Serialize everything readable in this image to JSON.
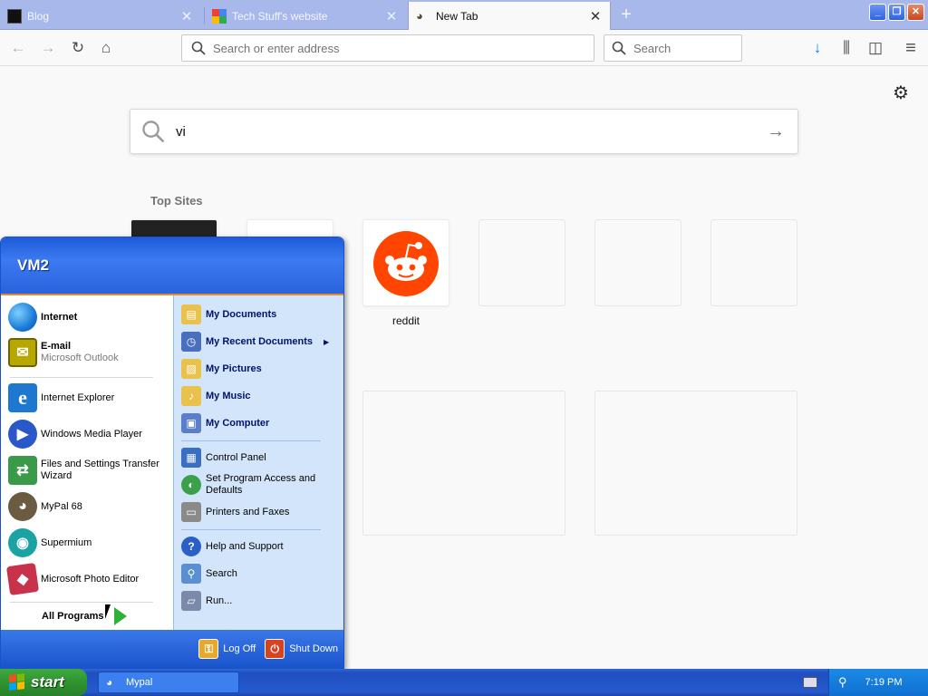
{
  "tabs": [
    {
      "title": "Blog",
      "favicon": "blog-favicon"
    },
    {
      "title": "Tech Stuff's website",
      "favicon": "google-favicon"
    },
    {
      "title": "New Tab",
      "favicon": "mypal-favicon",
      "active": true
    }
  ],
  "new_tab_symbol": "+",
  "window_controls": [
    "_",
    "❐",
    "✕"
  ],
  "toolbar": {
    "back_symbol": "←",
    "forward_symbol": "→",
    "reload_symbol": "↻",
    "home_symbol": "⌂",
    "url_placeholder": "Search or enter address",
    "search_placeholder": "Search",
    "download_symbol": "↓",
    "library_symbol": "⫼",
    "sidebar_symbol": "◫",
    "menu_symbol": "≡"
  },
  "newtab": {
    "search_value": "vi",
    "go_symbol": "→",
    "settings_symbol": "⚙",
    "top_sites_heading": "Top Sites",
    "tiles": [
      {
        "label": "reddit",
        "icon": "reddit-icon"
      }
    ]
  },
  "start_menu": {
    "user": "VM2",
    "pinned": [
      {
        "name": "Internet",
        "sub": "",
        "icon": "globe-icon",
        "color": "#1a7bd8"
      },
      {
        "name": "E-mail",
        "sub": "Microsoft Outlook",
        "icon": "outlook-icon",
        "color": "#b7a800"
      }
    ],
    "recent": [
      {
        "name": "Internet Explorer",
        "icon": "ie-icon",
        "color": "#1f78d0",
        "glyph": "e"
      },
      {
        "name": "Windows Media Player",
        "icon": "media-player-icon",
        "color": "#2a58c8",
        "glyph": "▶"
      },
      {
        "name": "Files and Settings Transfer Wizard",
        "icon": "transfer-wizard-icon",
        "color": "#3b9a4a",
        "glyph": "⇄"
      },
      {
        "name": "MyPal 68",
        "icon": "mypal-icon",
        "color": "#6b5b40",
        "glyph": "◕"
      },
      {
        "name": "Supermium",
        "icon": "supermium-icon",
        "color": "#1aa3a3",
        "glyph": "◉"
      },
      {
        "name": "Microsoft Photo Editor",
        "icon": "photo-editor-icon",
        "color": "#c8324a",
        "glyph": "◆"
      }
    ],
    "all_programs": "All Programs",
    "right_top": [
      {
        "name": "My Documents",
        "icon": "my-documents-icon",
        "color": "#e8c24a",
        "glyph": "▤"
      },
      {
        "name": "My Recent Documents",
        "icon": "recent-documents-icon",
        "color": "#4a6fbf",
        "glyph": "◷",
        "arrow": "▶"
      },
      {
        "name": "My Pictures",
        "icon": "my-pictures-icon",
        "color": "#e8c24a",
        "glyph": "▨"
      },
      {
        "name": "My Music",
        "icon": "my-music-icon",
        "color": "#e8c24a",
        "glyph": "♪"
      },
      {
        "name": "My Computer",
        "icon": "my-computer-icon",
        "color": "#5a7ec8",
        "glyph": "▣"
      }
    ],
    "right_mid": [
      {
        "name": "Control Panel",
        "icon": "control-panel-icon",
        "color": "#3a6ec0",
        "glyph": "▦"
      },
      {
        "name": "Set Program Access and Defaults",
        "icon": "program-access-icon",
        "color": "#3aa04a",
        "glyph": "◐"
      },
      {
        "name": "Printers and Faxes",
        "icon": "printer-icon",
        "color": "#8a8a8a",
        "glyph": "▭"
      }
    ],
    "right_bottom": [
      {
        "name": "Help and Support",
        "icon": "help-icon",
        "color": "#2a5fc8",
        "glyph": "?"
      },
      {
        "name": "Search",
        "icon": "search-icon",
        "color": "#5a8fd0",
        "glyph": "⚲"
      },
      {
        "name": "Run...",
        "icon": "run-icon",
        "color": "#7a8aa8",
        "glyph": "▱"
      }
    ],
    "log_off": "Log Off",
    "shut_down": "Shut Down"
  },
  "taskbar": {
    "start_label": "start",
    "task_label": "Mypal",
    "clock": "7:19 PM"
  },
  "colors": {
    "start_green": "#2d8f2e",
    "reddit_orange": "#ff4500",
    "xp_blue": "#2559cc"
  }
}
